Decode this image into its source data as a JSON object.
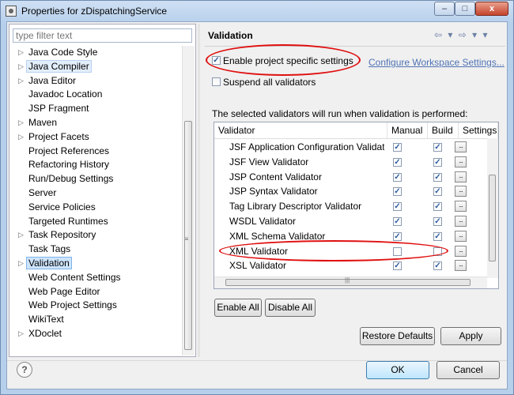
{
  "window": {
    "title": "Properties for zDispatchingService"
  },
  "filter": {
    "placeholder": "type filter text"
  },
  "tree": [
    {
      "label": "Java Code Style",
      "expandable": true
    },
    {
      "label": "Java Compiler",
      "expandable": true,
      "state": "hover"
    },
    {
      "label": "Java Editor",
      "expandable": true
    },
    {
      "label": "Javadoc Location",
      "expandable": false
    },
    {
      "label": "JSP Fragment",
      "expandable": false
    },
    {
      "label": "Maven",
      "expandable": true
    },
    {
      "label": "Project Facets",
      "expandable": true
    },
    {
      "label": "Project References",
      "expandable": false
    },
    {
      "label": "Refactoring History",
      "expandable": false
    },
    {
      "label": "Run/Debug Settings",
      "expandable": false
    },
    {
      "label": "Server",
      "expandable": false
    },
    {
      "label": "Service Policies",
      "expandable": false
    },
    {
      "label": "Targeted Runtimes",
      "expandable": false
    },
    {
      "label": "Task Repository",
      "expandable": true
    },
    {
      "label": "Task Tags",
      "expandable": false
    },
    {
      "label": "Validation",
      "expandable": true,
      "state": "selected"
    },
    {
      "label": "Web Content Settings",
      "expandable": false
    },
    {
      "label": "Web Page Editor",
      "expandable": false
    },
    {
      "label": "Web Project Settings",
      "expandable": false
    },
    {
      "label": "WikiText",
      "expandable": false
    },
    {
      "label": "XDoclet",
      "expandable": true
    }
  ],
  "page": {
    "title": "Validation",
    "enable_specific": {
      "label": "Enable project specific settings",
      "checked": true
    },
    "configure_link": "Configure Workspace Settings...",
    "suspend_all": {
      "label": "Suspend all validators",
      "checked": false
    },
    "info_text": "The selected validators will run when validation is performed:"
  },
  "table": {
    "columns": [
      "Validator",
      "Manual",
      "Build",
      "Settings"
    ],
    "rows": [
      {
        "name": "JSF Application Configuration Validator",
        "manual": true,
        "build": true
      },
      {
        "name": "JSF View Validator",
        "manual": true,
        "build": true
      },
      {
        "name": "JSP Content Validator",
        "manual": true,
        "build": true
      },
      {
        "name": "JSP Syntax Validator",
        "manual": true,
        "build": true
      },
      {
        "name": "Tag Library Descriptor Validator",
        "manual": true,
        "build": true
      },
      {
        "name": "WSDL Validator",
        "manual": true,
        "build": true
      },
      {
        "name": "XML Schema Validator",
        "manual": true,
        "build": true
      },
      {
        "name": "XML Validator",
        "manual": false,
        "build": false
      },
      {
        "name": "XSL Validator",
        "manual": true,
        "build": true
      }
    ],
    "settings_glyph": "..."
  },
  "buttons": {
    "enable_all": "Enable All",
    "disable_all": "Disable All",
    "restore_defaults": "Restore Defaults",
    "apply": "Apply",
    "ok": "OK",
    "cancel": "Cancel"
  },
  "icons": {
    "help": "?",
    "check": "✓",
    "expand": "▷",
    "scroll_grip": "≡",
    "hscroll_grip": "|||",
    "nav": "⇦ ▾ ⇨ ▾ ▾",
    "minimize": "–",
    "maximize": "□",
    "close": "x"
  },
  "colors": {
    "annotation": "#e01010",
    "link": "#5073b4"
  }
}
